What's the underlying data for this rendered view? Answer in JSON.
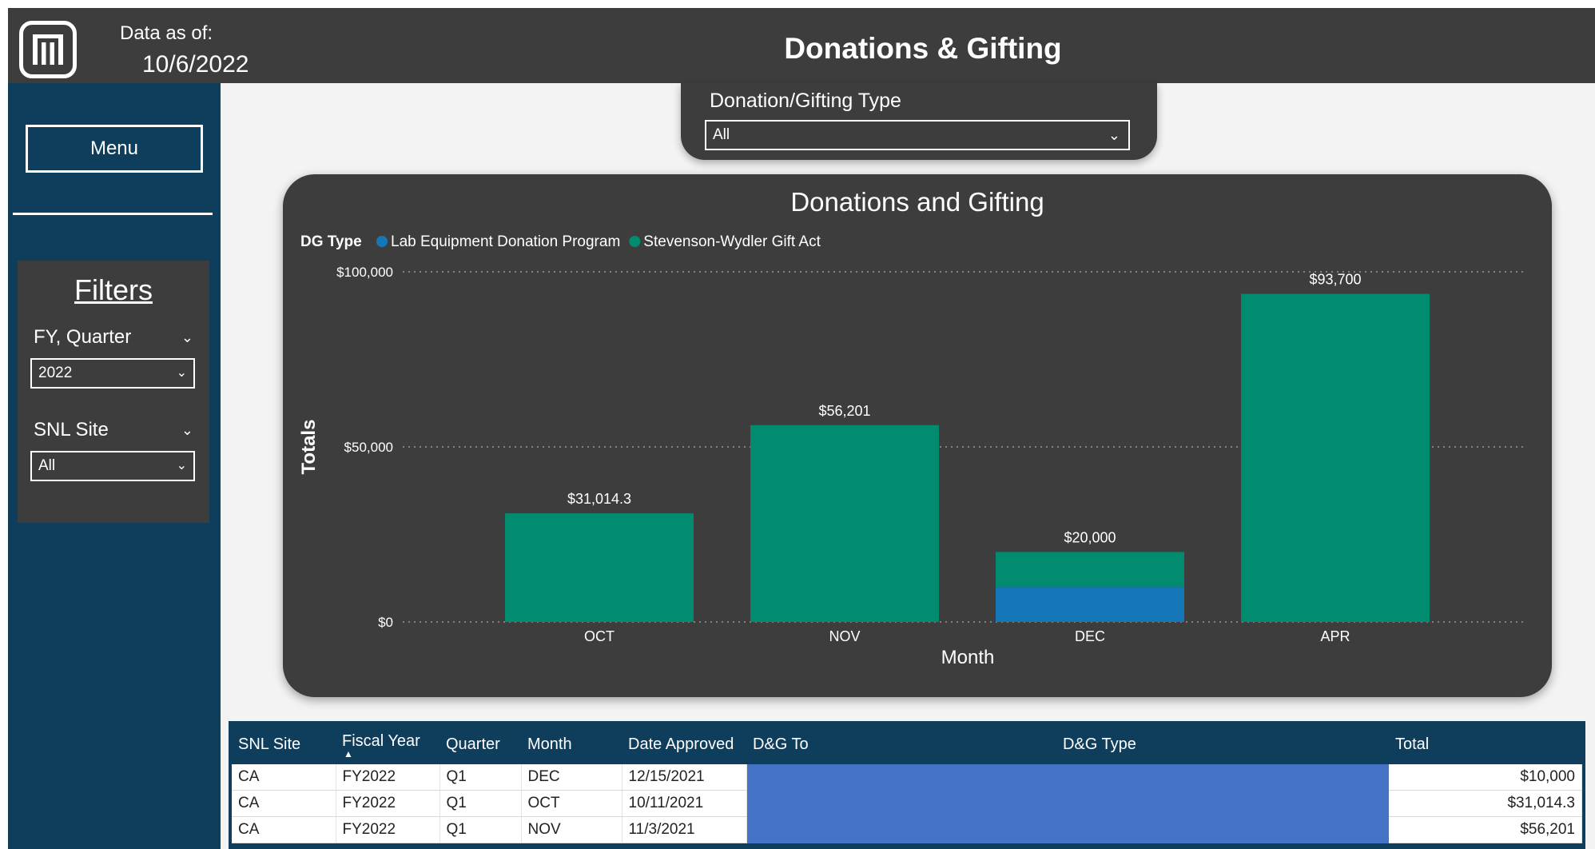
{
  "header": {
    "data_as_of_label": "Data as of:",
    "data_as_of_date": "10/6/2022",
    "title": "Donations & Gifting"
  },
  "sidebar": {
    "menu_label": "Menu",
    "filters_title": "Filters",
    "fy_quarter": {
      "label": "FY, Quarter",
      "value": "2022"
    },
    "snl_site": {
      "label": "SNL Site",
      "value": "All"
    }
  },
  "type_filter": {
    "label": "Donation/Gifting Type",
    "value": "All"
  },
  "chart_data": {
    "type": "bar",
    "title": "Donations and Gifting",
    "legend_title": "DG Type",
    "legend_placement": "top-left",
    "xlabel": "Month",
    "ylabel": "Totals",
    "ylim": [
      0,
      100000
    ],
    "yticks": [
      {
        "value": 0,
        "label": "$0"
      },
      {
        "value": 50000,
        "label": "$50,000"
      },
      {
        "value": 100000,
        "label": "$100,000"
      }
    ],
    "grid": true,
    "stacked": true,
    "categories": [
      "OCT",
      "NOV",
      "DEC",
      "APR"
    ],
    "series": [
      {
        "name": "Lab Equipment Donation Program",
        "color": "#1677b8",
        "values": [
          0,
          0,
          10000,
          0
        ]
      },
      {
        "name": "Stevenson-Wydler Gift Act",
        "color": "#018c70",
        "values": [
          31014.3,
          56201,
          10000,
          93700
        ]
      }
    ],
    "total_labels": [
      "$31,014.3",
      "$56,201",
      "$20,000",
      "$93,700"
    ]
  },
  "table": {
    "headers": [
      "SNL Site",
      "Fiscal Year",
      "Quarter",
      "Month",
      "Date Approved",
      "D&G To",
      "D&G Type",
      "Total"
    ],
    "rows": [
      [
        "CA",
        "FY2022",
        "Q1",
        "DEC",
        "12/15/2021",
        "",
        "",
        "$10,000"
      ],
      [
        "CA",
        "FY2022",
        "Q1",
        "OCT",
        "10/11/2021",
        "",
        "",
        "$31,014.3"
      ],
      [
        "CA",
        "FY2022",
        "Q1",
        "NOV",
        "11/3/2021",
        "",
        "",
        "$56,201"
      ]
    ]
  }
}
